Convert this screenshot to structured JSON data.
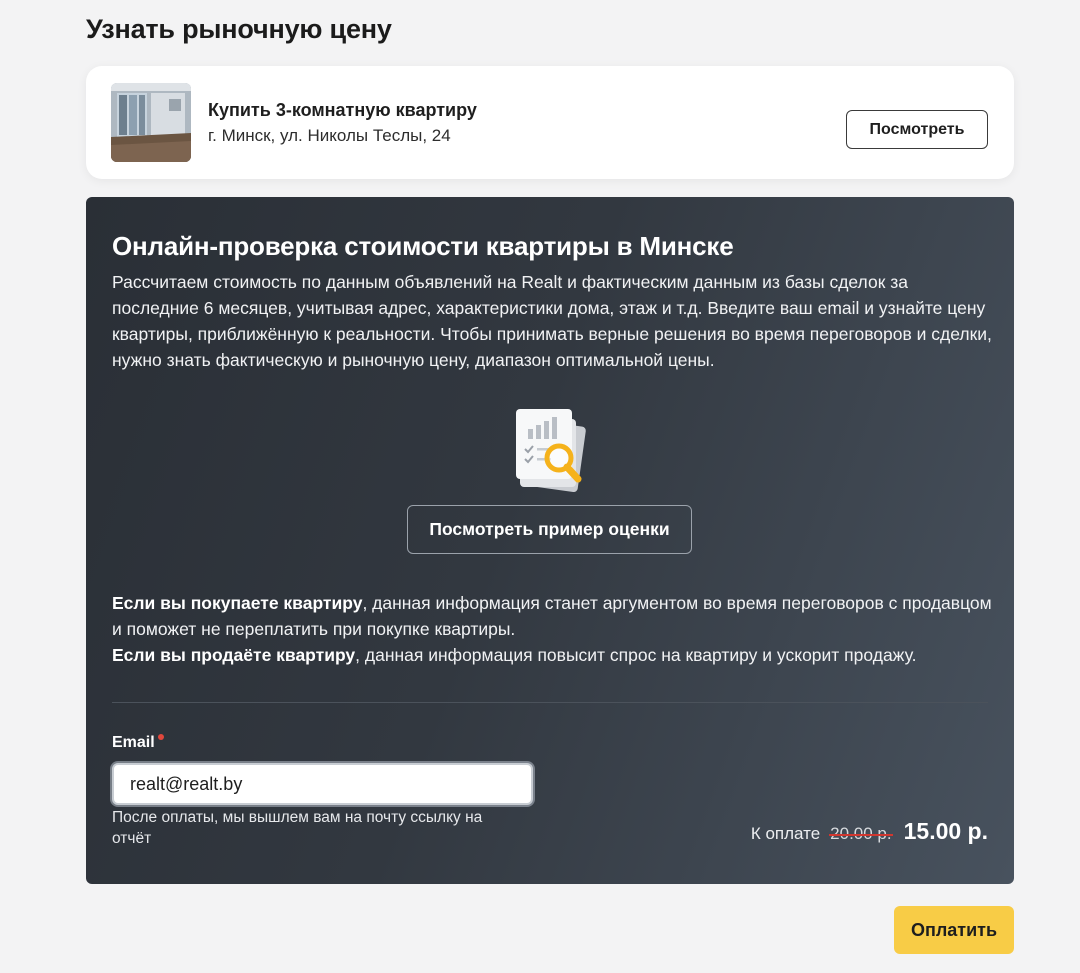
{
  "page": {
    "title": "Узнать рыночную цену"
  },
  "listing": {
    "title": "Купить 3-комнатную квартиру",
    "address": "г. Минск, ул. Николы Теслы, 24",
    "view_label": "Посмотреть",
    "thumbnail_icon": "apartment-photo"
  },
  "promo": {
    "heading": "Онлайн-проверка стоимости квартиры в Минске",
    "description": "Рассчитаем стоимость по данным объявлений на Realt и фактическим данным из базы сделок за последние 6 месяцев, учитывая адрес, характеристики дома, этаж и т.д. Введите ваш email и узнайте цену квартиры, приближённую к реальности. Чтобы принимать верные решения во время переговоров и сделки, нужно знать фактическую и рыночную цену, диапазон оптимальной цены.",
    "illustration_icon": "report-magnifier-icon",
    "example_label": "Посмотреть пример оценки",
    "buyer_bold": "Если вы покупаете квартиру",
    "buyer_text": ", данная информация станет аргументом во время переговоров с продавцом и поможет не переплатить при покупке квартиры.",
    "seller_bold": "Если вы продаёте квартиру",
    "seller_text": ", данная информация повысит спрос на квартиру и ускорит продажу."
  },
  "form": {
    "email_label": "Email",
    "email_value": "realt@realt.by",
    "email_hint": "После оплаты, мы вышлем вам на почту ссылку на отчёт"
  },
  "price": {
    "label": "К оплате",
    "old": "20.00 р.",
    "new": "15.00 р."
  },
  "actions": {
    "pay_label": "Оплатить"
  },
  "colors": {
    "accent": "#f8cc46",
    "panel": "#2f353c",
    "required": "#e0473c",
    "strike": "#d1372f"
  }
}
